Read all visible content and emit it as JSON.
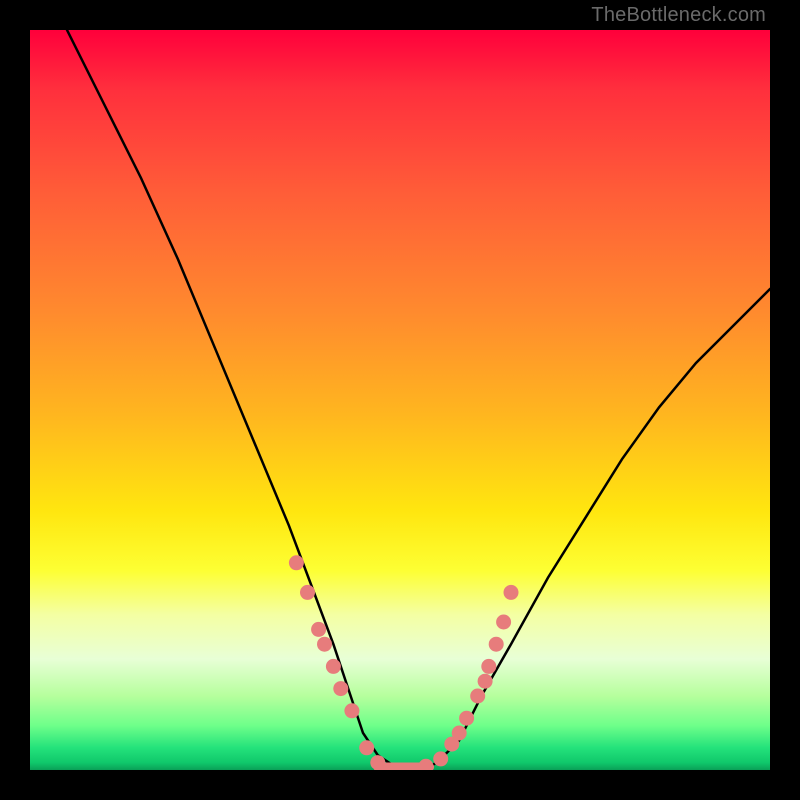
{
  "watermark": "TheBottleneck.com",
  "chart_data": {
    "type": "line",
    "title": "",
    "xlabel": "",
    "ylabel": "",
    "xlim": [
      0,
      100
    ],
    "ylim": [
      0,
      100
    ],
    "series": [
      {
        "name": "curve",
        "x": [
          5,
          10,
          15,
          20,
          25,
          30,
          35,
          38,
          41,
          43,
          45,
          47,
          50,
          53,
          55,
          58,
          61,
          65,
          70,
          75,
          80,
          85,
          90,
          95,
          100
        ],
        "y": [
          100,
          90,
          80,
          69,
          57,
          45,
          33,
          25,
          17,
          11,
          5,
          2,
          0,
          0,
          1,
          4,
          10,
          17,
          26,
          34,
          42,
          49,
          55,
          60,
          65
        ]
      }
    ],
    "markers": {
      "name": "highlight-dots",
      "color": "#e77c7c",
      "x": [
        36,
        37.5,
        39,
        39.8,
        41,
        42,
        43.5,
        45.5,
        47,
        53.5,
        55.5,
        57,
        58,
        59,
        60.5,
        61.5,
        62,
        63,
        64,
        65
      ],
      "y": [
        28,
        24,
        19,
        17,
        14,
        11,
        8,
        3,
        1,
        0.5,
        1.5,
        3.5,
        5,
        7,
        10,
        12,
        14,
        17,
        20,
        24
      ]
    },
    "flat_segment": {
      "x0": 47,
      "x1": 54,
      "y": 0
    },
    "gradient_stops": [
      {
        "pos": 0,
        "color": "#ff003b"
      },
      {
        "pos": 22,
        "color": "#ff5d38"
      },
      {
        "pos": 52,
        "color": "#ffb61f"
      },
      {
        "pos": 73,
        "color": "#fdff33"
      },
      {
        "pos": 90,
        "color": "#b6ff9d"
      },
      {
        "pos": 100,
        "color": "#0aa057"
      }
    ]
  }
}
